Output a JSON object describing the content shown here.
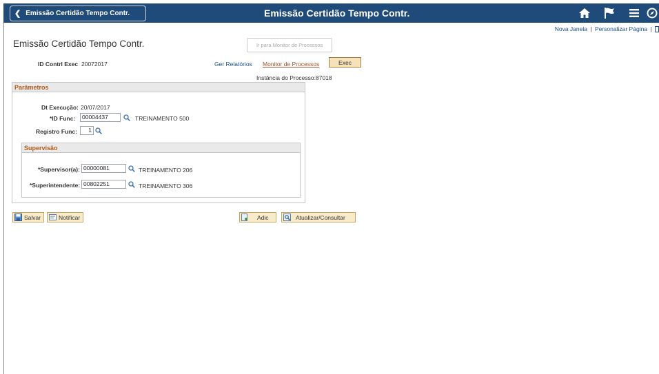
{
  "header": {
    "back_label": "Emissão Certidão Tempo Contr.",
    "title": "Emissão Certidão Tempo Contr.",
    "icons": [
      "home-icon",
      "flag-icon",
      "menu-icon",
      "navbar-icon"
    ]
  },
  "toplinks": {
    "new_window": "Nova Janela",
    "personalize": "Personalizar Página",
    "separator": "|"
  },
  "page": {
    "title": "Emissão Certidão Tempo Contr.",
    "go_to_monitor_button": "Ir para Monitor de Processos",
    "run_control_label": "ID Contrl Exec",
    "run_control_value": "20072017",
    "report_manager_link": "Ger Relatórios",
    "process_monitor_link": "Monitor de Processos",
    "exec_button": "Exec",
    "process_instance_label": "Instância do Processo:",
    "process_instance_value": "87018"
  },
  "parametros": {
    "header": "Parâmetros",
    "dt_execucao_label": "Dt Execução:",
    "dt_execucao_value": "20/07/2017",
    "id_func_label": "*ID Func:",
    "id_func_value": "00004437",
    "id_func_desc": "TREINAMENTO 500",
    "registro_label": "Registro Func:",
    "registro_value": "1"
  },
  "supervisao": {
    "header": "Supervisão",
    "supervisor_label": "*Supervisor(a):",
    "supervisor_value": "00000081",
    "supervisor_desc": "TREINAMENTO 206",
    "superintendente_label": "*Superintendente:",
    "superintendente_value": "00802251",
    "superintendente_desc": "TREINAMENTO 306"
  },
  "toolbar": {
    "save": "Salvar",
    "notify": "Notificar",
    "add": "Adic",
    "update": "Atualizar/Consultar"
  },
  "colors": {
    "banner": "#1f4b7a",
    "link": "#1d4f91",
    "group_header_text": "#b45a1c",
    "button_bg": "#f8ebc9"
  }
}
